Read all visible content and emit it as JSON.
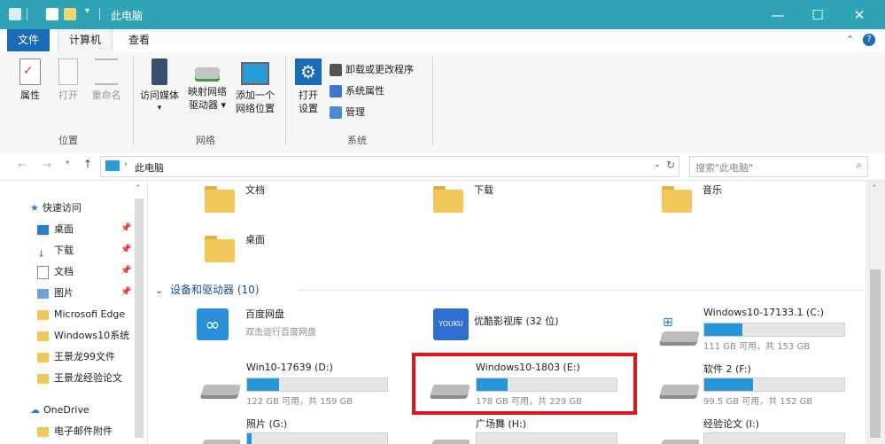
{
  "window": {
    "title": "此电脑",
    "controls": {
      "minimize": "—",
      "maximize": "☐",
      "close": "✕"
    }
  },
  "tabs": [
    {
      "label": "文件"
    },
    {
      "label": "计算机"
    },
    {
      "label": "查看"
    }
  ],
  "ribbon": {
    "location_group": {
      "label": "位置",
      "items": [
        {
          "label": "属性"
        },
        {
          "label": "打开"
        },
        {
          "label": "重命名"
        }
      ]
    },
    "network_group": {
      "label": "网络",
      "items": [
        {
          "label": "访问媒体"
        },
        {
          "label": "映射网络",
          "label2": "驱动器 ▾"
        },
        {
          "label": "添加一个",
          "label2": "网络位置"
        }
      ]
    },
    "system_group": {
      "label": "系统",
      "open_settings": {
        "label": "打开",
        "label2": "设置"
      },
      "small_items": [
        {
          "label": "卸载或更改程序"
        },
        {
          "label": "系统属性"
        },
        {
          "label": "管理"
        }
      ]
    }
  },
  "address": {
    "path": "此电脑",
    "search_placeholder": "搜索\"此电脑\""
  },
  "nav": {
    "quick_access": "快速访问",
    "items": [
      {
        "label": "桌面"
      },
      {
        "label": "下载"
      },
      {
        "label": "文档"
      },
      {
        "label": "图片"
      },
      {
        "label": "Microsofi Edge"
      },
      {
        "label": "Windows10系统"
      },
      {
        "label": "王景龙99文件"
      },
      {
        "label": "王景龙经验论文"
      }
    ],
    "onedrive": "OneDrive",
    "onedrive_item": "电子邮件附件"
  },
  "folders": [
    {
      "label": "文档"
    },
    {
      "label": "下载"
    },
    {
      "label": "音乐"
    },
    {
      "label": "桌面"
    }
  ],
  "devices": {
    "header": "设备和驱动器 (10)",
    "baidu": {
      "name": "百度网盘",
      "sub": "双击运行百度网盘"
    },
    "youku": {
      "name": "优酷影视库 (32 位)",
      "logo": "YOUKU"
    },
    "drives": [
      {
        "name": "Windows10-17133.1 (C:)",
        "size": "111 GB 可用，共 153 GB",
        "used": 0.27
      },
      {
        "name": "Win10-17639 (D:)",
        "size": "122 GB 可用，共 159 GB",
        "used": 0.23
      },
      {
        "name": "Windows10-1803 (E:)",
        "size": "178 GB 可用，共 229 GB",
        "used": 0.22
      },
      {
        "name": "软件 2 (F:)",
        "size": "99.5 GB 可用，共 152 GB",
        "used": 0.35
      },
      {
        "name": "照片 (G:)",
        "size": "",
        "used": 0.03
      },
      {
        "name": "广场舞 (H:)",
        "size": "",
        "used": 0.0
      },
      {
        "name": "经验论文 (I:)",
        "size": "",
        "used": 0.0
      }
    ]
  },
  "colors": {
    "titlebar": "#2ea4b6",
    "file_tab": "#1a6bb8",
    "progress": "#2696d8",
    "highlight": "#e0161b"
  }
}
